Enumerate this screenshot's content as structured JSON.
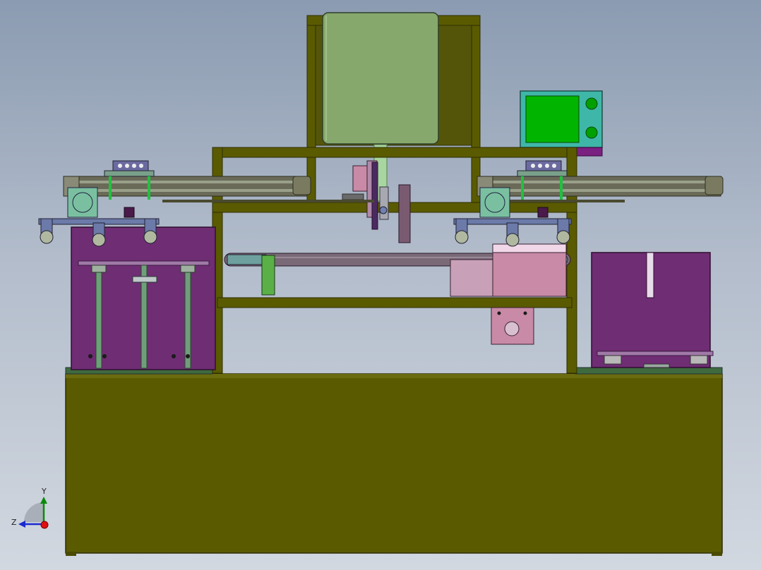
{
  "triad": {
    "y_label": "Y",
    "z_label": "Z"
  },
  "colors": {
    "frame": "#5a5a00",
    "frame_dark": "#3c3c00",
    "purple": "#6f2d73",
    "hopper_green": "#87a86c",
    "monitor_teal": "#3fb7a8",
    "screen_green": "#00b400",
    "pink": "#c88aa6"
  }
}
